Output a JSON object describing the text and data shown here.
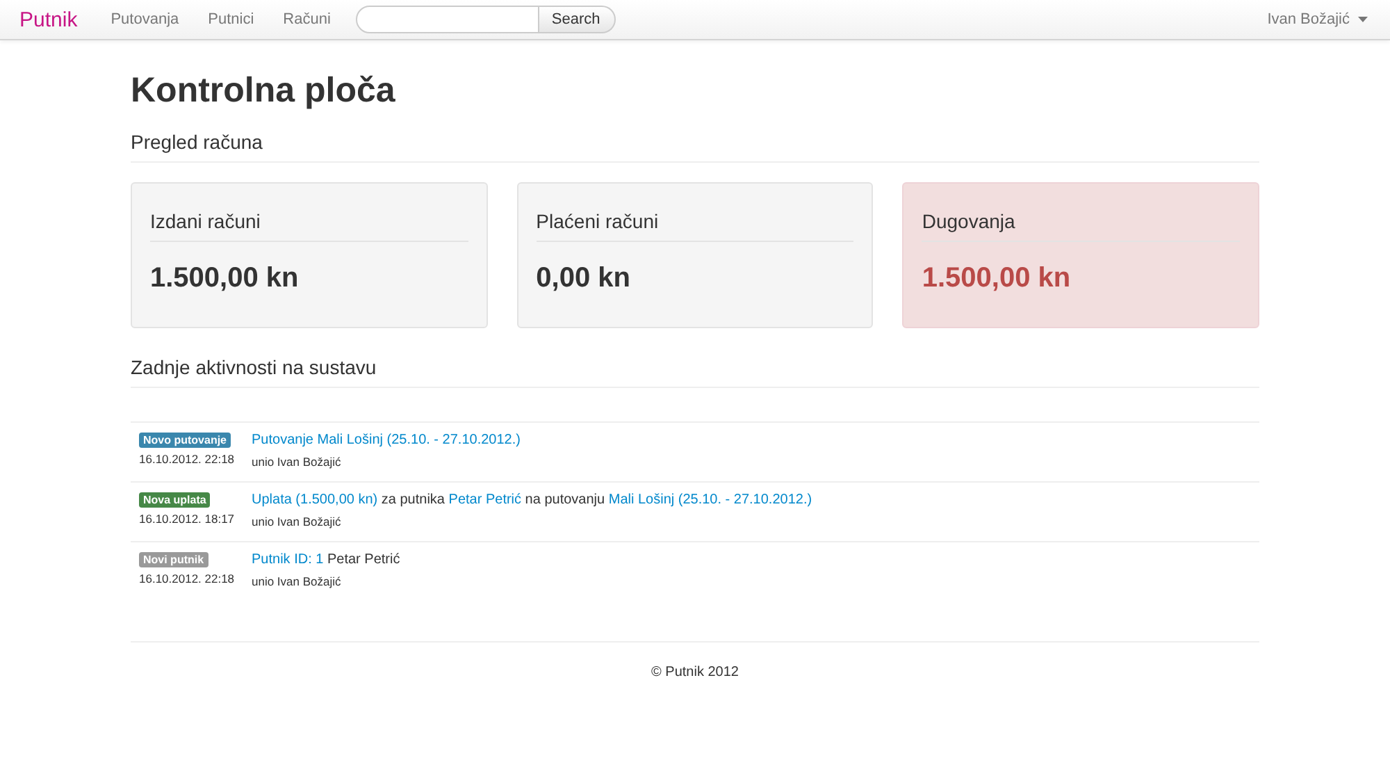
{
  "navbar": {
    "brand": "Putnik",
    "links": [
      {
        "label": "Putovanja",
        "selected": false
      },
      {
        "label": "Putnici",
        "selected": false
      },
      {
        "label": "Računi",
        "selected": false
      }
    ],
    "search": {
      "button": "Search"
    },
    "user": "Ivan Božajić"
  },
  "title": "Kontrolna ploča",
  "overview": {
    "heading": "Pregled računa",
    "cards": [
      {
        "label": "Izdani računi",
        "value": "1.500,00 kn",
        "kind": "normal"
      },
      {
        "label": "Plaćeni računi",
        "value": "0,00 kn",
        "kind": "normal"
      },
      {
        "label": "Dugovanja",
        "value": "1.500,00 kn",
        "kind": "danger"
      }
    ]
  },
  "activity": {
    "heading": "Zadnje aktivnosti na sustavu",
    "items": [
      {
        "badge": "Novo putovanje",
        "color": "#3a87ad",
        "time": "16.10.2012. 22:18",
        "parts": [
          {
            "text": "Putovanje Mali Lošinj (25.10. - 27.10.2012.)",
            "link": true
          }
        ],
        "author": "unio Ivan Božajić"
      },
      {
        "badge": "Nova uplata",
        "color": "#468847",
        "time": "16.10.2012. 18:17",
        "parts": [
          {
            "text": "Uplata (1.500,00 kn)",
            "link": true
          },
          {
            "text": " za putnika ",
            "link": false
          },
          {
            "text": "Petar Petrić",
            "link": true
          },
          {
            "text": " na putovanju ",
            "link": false
          },
          {
            "text": "Mali Lošinj (25.10. - 27.10.2012.)",
            "link": true
          }
        ],
        "author": "unio Ivan Božajić"
      },
      {
        "badge": "Novi putnik",
        "color": "#999999",
        "time": "16.10.2012. 22:18",
        "parts": [
          {
            "text": "Putnik ID: 1",
            "link": true
          },
          {
            "text": " Petar Petrić",
            "link": false
          }
        ],
        "author": "unio Ivan Božajić"
      }
    ]
  },
  "footer": "© Putnik 2012"
}
